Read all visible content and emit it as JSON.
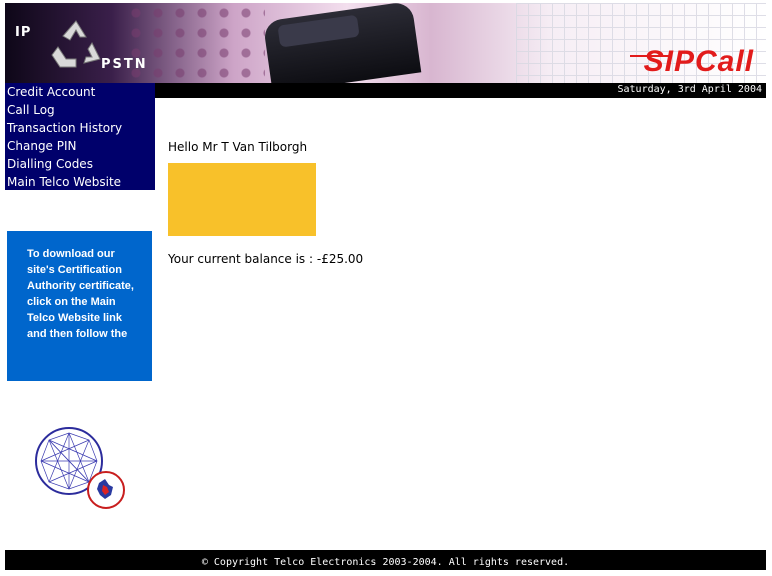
{
  "header": {
    "logo_top_text": "IP",
    "logo_bottom_text": "PSTN",
    "brand": "SIPCall",
    "brand_color": "#e21b1b",
    "logo_icon": "recycle-icon"
  },
  "date_bar": {
    "date": "Saturday, 3rd April 2004"
  },
  "nav": {
    "items": [
      {
        "label": "Credit Account"
      },
      {
        "label": "Call Log"
      },
      {
        "label": "Transaction History"
      },
      {
        "label": "Change PIN"
      },
      {
        "label": "Dialling Codes"
      },
      {
        "label": "Main Telco Website"
      }
    ],
    "background": "#00006b"
  },
  "info_box": {
    "text": "To download our site's Certification Authority certificate, click on the Main Telco Website link and then follow the",
    "background": "#0066cc"
  },
  "main": {
    "greeting": "Hello Mr T Van Tilborgh",
    "banner_color": "#f8c12a",
    "balance_label": "Your current balance is : ",
    "balance_value": "-£25.00"
  },
  "footer": {
    "copyright": "© Copyright Telco Electronics 2003-2004. All rights reserved."
  },
  "badge_icon": "network-globe-icon"
}
